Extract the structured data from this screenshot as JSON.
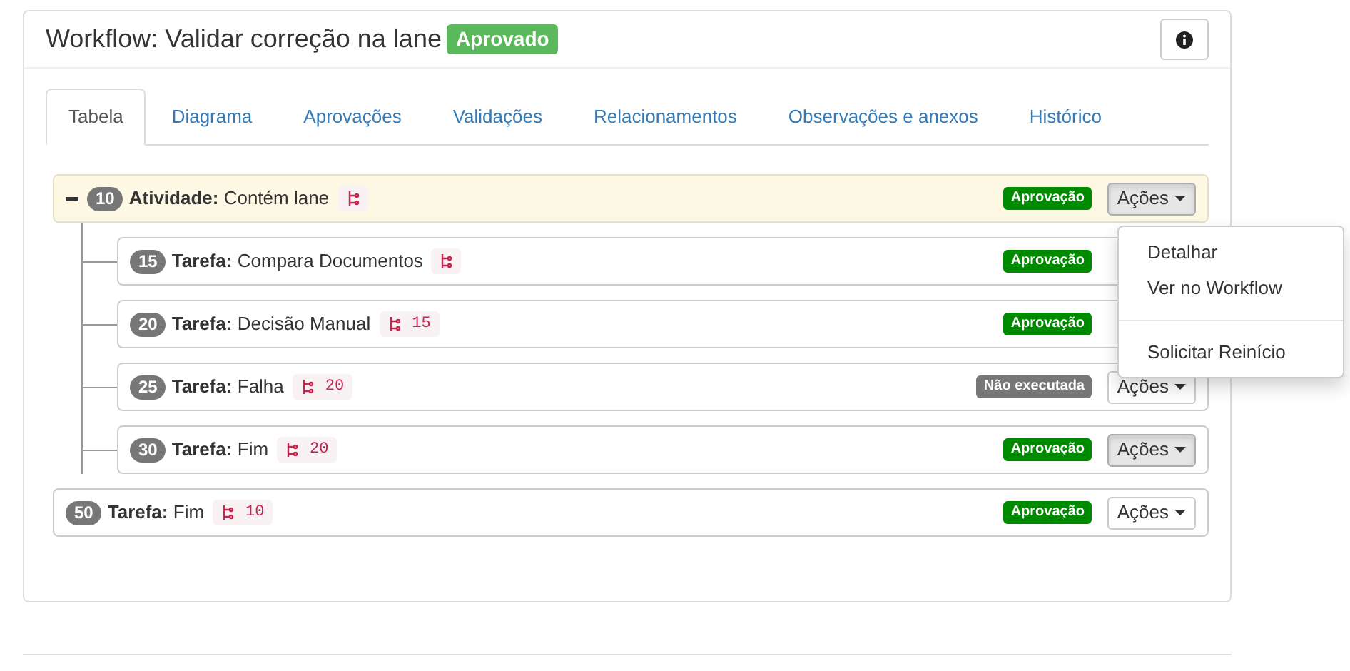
{
  "header": {
    "title": "Workflow: Validar correção na lane",
    "status": "Aprovado"
  },
  "tabs": [
    {
      "label": "Tabela",
      "selected": true
    },
    {
      "label": "Diagrama",
      "selected": false
    },
    {
      "label": "Aprovações",
      "selected": false
    },
    {
      "label": "Validações",
      "selected": false
    },
    {
      "label": "Relacionamentos",
      "selected": false
    },
    {
      "label": "Observações e anexos",
      "selected": false
    },
    {
      "label": "Histórico",
      "selected": false
    }
  ],
  "items": [
    {
      "number": "10",
      "type": "Atividade:",
      "name": "Contém lane",
      "expanded": true,
      "badge": {
        "kind": "approved",
        "label": "Aprovação"
      },
      "actions": {
        "label": "Ações",
        "pressed": true,
        "menu": [
          {
            "kind": "item",
            "label": "Detalhar"
          },
          {
            "kind": "item",
            "label": "Ver no Workflow"
          },
          {
            "kind": "divider"
          },
          {
            "kind": "item",
            "label": "Solicitar Reinício"
          }
        ]
      },
      "children": [
        {
          "number": "15",
          "type": "Tarefa:",
          "name": "Compara Documentos",
          "badge": {
            "kind": "approved",
            "label": "Aprovação"
          }
        },
        {
          "number": "20",
          "type": "Tarefa:",
          "name": "Decisão Manual",
          "ref": "15",
          "badge": {
            "kind": "approved",
            "label": "Aprovação"
          }
        },
        {
          "number": "25",
          "type": "Tarefa:",
          "name": "Falha",
          "ref": "20",
          "badge": {
            "kind": "not_executed",
            "label": "Não executada"
          },
          "actions": {
            "label": "Ações",
            "pressed": false
          }
        },
        {
          "number": "30",
          "type": "Tarefa:",
          "name": "Fim",
          "ref": "20",
          "badge": {
            "kind": "approved",
            "label": "Aprovação"
          },
          "actions": {
            "label": "Ações",
            "pressed": true
          }
        }
      ]
    },
    {
      "number": "50",
      "type": "Tarefa:",
      "name": "Fim",
      "ref": "10",
      "badge": {
        "kind": "approved",
        "label": "Aprovação"
      },
      "actions": {
        "label": "Ações",
        "pressed": false
      }
    }
  ]
}
